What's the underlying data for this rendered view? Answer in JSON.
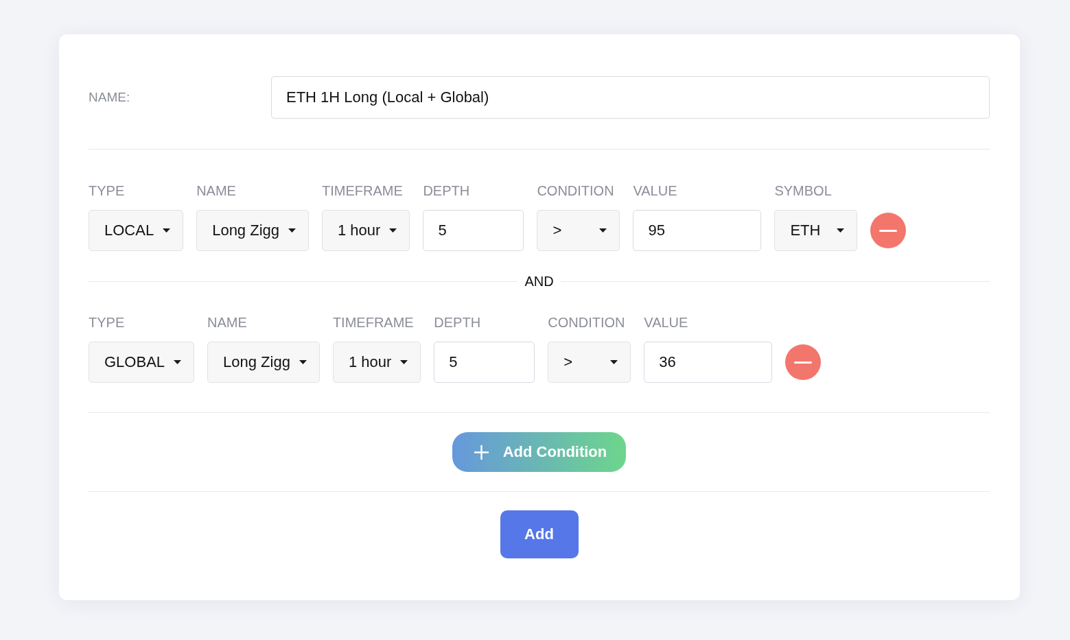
{
  "name_field": {
    "label": "NAME:",
    "value": "ETH 1H Long (Local + Global)"
  },
  "conditions": [
    {
      "fields": [
        {
          "label": "TYPE",
          "kind": "select",
          "value": "LOCAL"
        },
        {
          "label": "NAME",
          "kind": "select",
          "value": "Long Zigg"
        },
        {
          "label": "TIMEFRAME",
          "kind": "select",
          "value": "1 hour"
        },
        {
          "label": "DEPTH",
          "kind": "input",
          "value": "5"
        },
        {
          "label": "CONDITION",
          "kind": "select",
          "value": ">"
        },
        {
          "label": "VALUE",
          "kind": "input",
          "value": "95"
        },
        {
          "label": "SYMBOL",
          "kind": "select",
          "value": "ETH"
        }
      ]
    },
    {
      "join": "AND",
      "fields": [
        {
          "label": "TYPE",
          "kind": "select",
          "value": "GLOBAL"
        },
        {
          "label": "NAME",
          "kind": "select",
          "value": "Long Zigg"
        },
        {
          "label": "TIMEFRAME",
          "kind": "select",
          "value": "1 hour"
        },
        {
          "label": "DEPTH",
          "kind": "input",
          "value": "5"
        },
        {
          "label": "CONDITION",
          "kind": "select",
          "value": ">"
        },
        {
          "label": "VALUE",
          "kind": "input",
          "value": "36"
        }
      ]
    }
  ],
  "add_condition_button": {
    "label": "Add Condition"
  },
  "add_button": {
    "label": "Add"
  }
}
